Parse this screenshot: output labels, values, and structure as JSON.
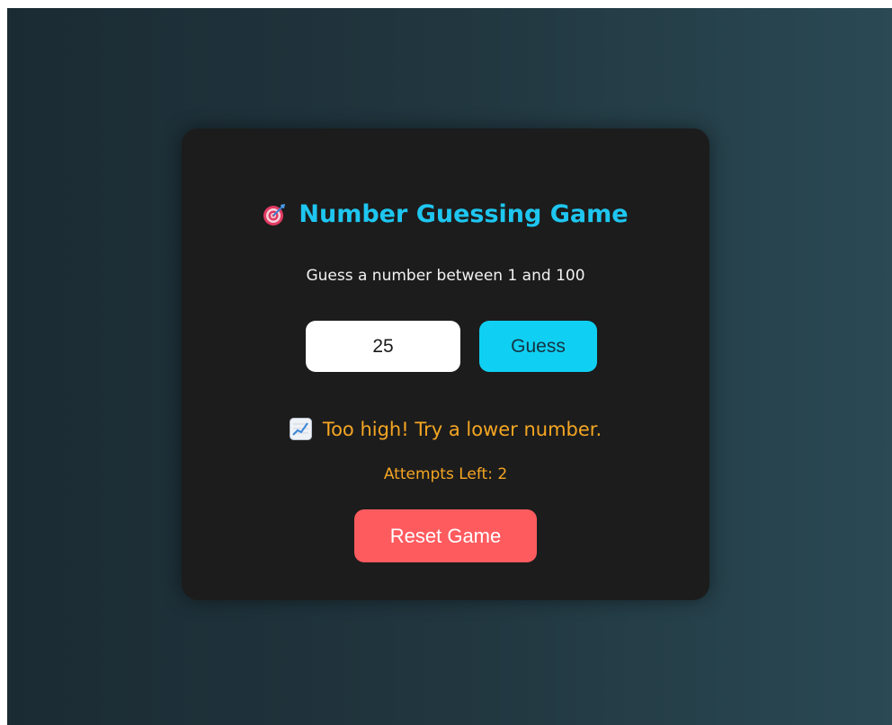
{
  "game": {
    "title": "Number Guessing Game",
    "title_icon": "target-icon",
    "instructions": "Guess a number between 1 and 100",
    "guess_input": {
      "value": "25",
      "placeholder": ""
    },
    "guess_button_label": "Guess",
    "feedback": {
      "icon": "chart-increasing-icon",
      "message": "Too high! Try a lower number."
    },
    "attempts_label": "Attempts Left: ",
    "attempts_left": "2",
    "reset_button_label": "Reset Game"
  },
  "colors": {
    "title": "#1ec6f0",
    "guess_button": "#0fd0f2",
    "feedback": "#f5a623",
    "reset_button": "#fe5b5f",
    "card": "#1c1c1c"
  }
}
